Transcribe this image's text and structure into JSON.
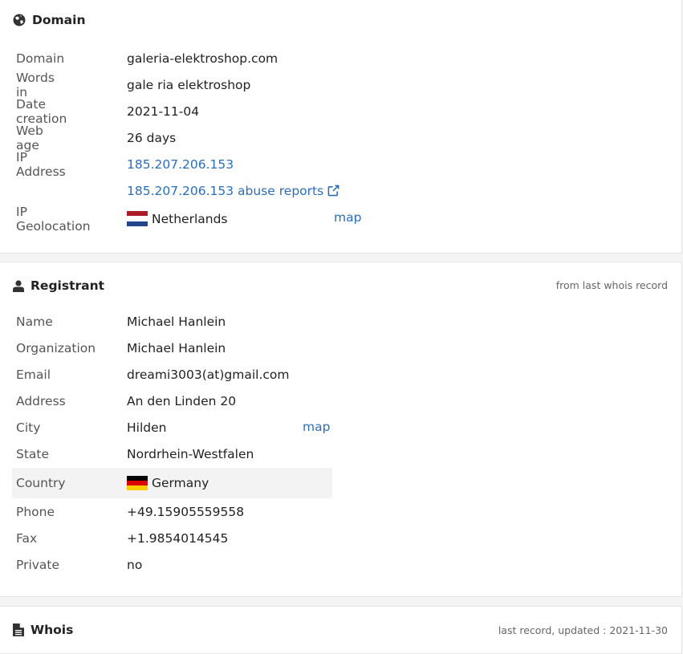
{
  "domain_panel": {
    "title": "Domain",
    "rows": [
      {
        "label": "Domain",
        "value": "galeria-elektroshop.com"
      },
      {
        "label": "Words in",
        "value": "gale ria elektroshop"
      },
      {
        "label": "Date creation",
        "value": "2021-11-04"
      },
      {
        "label": "Web age",
        "value": "26 days"
      },
      {
        "label": "IP Address",
        "value": "185.207.206.153"
      },
      {
        "label": "",
        "value": "185.207.206.153 abuse reports"
      },
      {
        "label": "IP Geolocation",
        "value": "Netherlands",
        "map": "map"
      }
    ]
  },
  "registrant_panel": {
    "title": "Registrant",
    "note": "from last whois record",
    "rows": [
      {
        "label": "Name",
        "value": "Michael Hanlein"
      },
      {
        "label": "Organization",
        "value": "Michael Hanlein"
      },
      {
        "label": "Email",
        "value": "dreami3003(at)gmail.com"
      },
      {
        "label": "Address",
        "value": "An den Linden 20"
      },
      {
        "label": "City",
        "value": "Hilden",
        "map": "map"
      },
      {
        "label": "State",
        "value": "Nordrhein-Westfalen"
      },
      {
        "label": "Country",
        "value": "Germany"
      },
      {
        "label": "Phone",
        "value": "+49.15905559558"
      },
      {
        "label": "Fax",
        "value": "+1.9854014545"
      },
      {
        "label": "Private",
        "value": "no"
      }
    ]
  },
  "whois_panel": {
    "title": "Whois",
    "note": "last record, updated : 2021-11-30"
  },
  "colors": {
    "link": "#2a6ebb",
    "highlight_row": "#f3f3f3"
  },
  "icons": {
    "domain": "globe-icon",
    "registrant": "user-icon",
    "whois": "file-text-icon",
    "external": "external-link-icon"
  }
}
